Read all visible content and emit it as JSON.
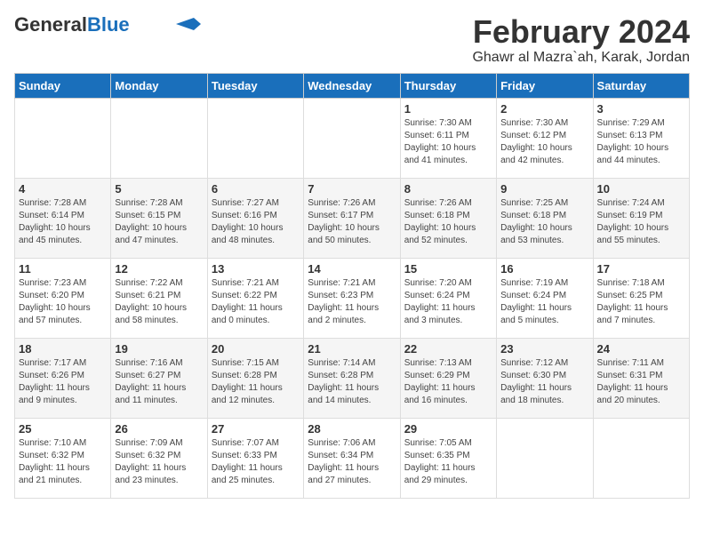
{
  "header": {
    "logo_general": "General",
    "logo_blue": "Blue",
    "title": "February 2024",
    "subtitle": "Ghawr al Mazra`ah, Karak, Jordan"
  },
  "weekdays": [
    "Sunday",
    "Monday",
    "Tuesday",
    "Wednesday",
    "Thursday",
    "Friday",
    "Saturday"
  ],
  "weeks": [
    [
      {
        "day": "",
        "info": ""
      },
      {
        "day": "",
        "info": ""
      },
      {
        "day": "",
        "info": ""
      },
      {
        "day": "",
        "info": ""
      },
      {
        "day": "1",
        "info": "Sunrise: 7:30 AM\nSunset: 6:11 PM\nDaylight: 10 hours\nand 41 minutes."
      },
      {
        "day": "2",
        "info": "Sunrise: 7:30 AM\nSunset: 6:12 PM\nDaylight: 10 hours\nand 42 minutes."
      },
      {
        "day": "3",
        "info": "Sunrise: 7:29 AM\nSunset: 6:13 PM\nDaylight: 10 hours\nand 44 minutes."
      }
    ],
    [
      {
        "day": "4",
        "info": "Sunrise: 7:28 AM\nSunset: 6:14 PM\nDaylight: 10 hours\nand 45 minutes."
      },
      {
        "day": "5",
        "info": "Sunrise: 7:28 AM\nSunset: 6:15 PM\nDaylight: 10 hours\nand 47 minutes."
      },
      {
        "day": "6",
        "info": "Sunrise: 7:27 AM\nSunset: 6:16 PM\nDaylight: 10 hours\nand 48 minutes."
      },
      {
        "day": "7",
        "info": "Sunrise: 7:26 AM\nSunset: 6:17 PM\nDaylight: 10 hours\nand 50 minutes."
      },
      {
        "day": "8",
        "info": "Sunrise: 7:26 AM\nSunset: 6:18 PM\nDaylight: 10 hours\nand 52 minutes."
      },
      {
        "day": "9",
        "info": "Sunrise: 7:25 AM\nSunset: 6:18 PM\nDaylight: 10 hours\nand 53 minutes."
      },
      {
        "day": "10",
        "info": "Sunrise: 7:24 AM\nSunset: 6:19 PM\nDaylight: 10 hours\nand 55 minutes."
      }
    ],
    [
      {
        "day": "11",
        "info": "Sunrise: 7:23 AM\nSunset: 6:20 PM\nDaylight: 10 hours\nand 57 minutes."
      },
      {
        "day": "12",
        "info": "Sunrise: 7:22 AM\nSunset: 6:21 PM\nDaylight: 10 hours\nand 58 minutes."
      },
      {
        "day": "13",
        "info": "Sunrise: 7:21 AM\nSunset: 6:22 PM\nDaylight: 11 hours\nand 0 minutes."
      },
      {
        "day": "14",
        "info": "Sunrise: 7:21 AM\nSunset: 6:23 PM\nDaylight: 11 hours\nand 2 minutes."
      },
      {
        "day": "15",
        "info": "Sunrise: 7:20 AM\nSunset: 6:24 PM\nDaylight: 11 hours\nand 3 minutes."
      },
      {
        "day": "16",
        "info": "Sunrise: 7:19 AM\nSunset: 6:24 PM\nDaylight: 11 hours\nand 5 minutes."
      },
      {
        "day": "17",
        "info": "Sunrise: 7:18 AM\nSunset: 6:25 PM\nDaylight: 11 hours\nand 7 minutes."
      }
    ],
    [
      {
        "day": "18",
        "info": "Sunrise: 7:17 AM\nSunset: 6:26 PM\nDaylight: 11 hours\nand 9 minutes."
      },
      {
        "day": "19",
        "info": "Sunrise: 7:16 AM\nSunset: 6:27 PM\nDaylight: 11 hours\nand 11 minutes."
      },
      {
        "day": "20",
        "info": "Sunrise: 7:15 AM\nSunset: 6:28 PM\nDaylight: 11 hours\nand 12 minutes."
      },
      {
        "day": "21",
        "info": "Sunrise: 7:14 AM\nSunset: 6:28 PM\nDaylight: 11 hours\nand 14 minutes."
      },
      {
        "day": "22",
        "info": "Sunrise: 7:13 AM\nSunset: 6:29 PM\nDaylight: 11 hours\nand 16 minutes."
      },
      {
        "day": "23",
        "info": "Sunrise: 7:12 AM\nSunset: 6:30 PM\nDaylight: 11 hours\nand 18 minutes."
      },
      {
        "day": "24",
        "info": "Sunrise: 7:11 AM\nSunset: 6:31 PM\nDaylight: 11 hours\nand 20 minutes."
      }
    ],
    [
      {
        "day": "25",
        "info": "Sunrise: 7:10 AM\nSunset: 6:32 PM\nDaylight: 11 hours\nand 21 minutes."
      },
      {
        "day": "26",
        "info": "Sunrise: 7:09 AM\nSunset: 6:32 PM\nDaylight: 11 hours\nand 23 minutes."
      },
      {
        "day": "27",
        "info": "Sunrise: 7:07 AM\nSunset: 6:33 PM\nDaylight: 11 hours\nand 25 minutes."
      },
      {
        "day": "28",
        "info": "Sunrise: 7:06 AM\nSunset: 6:34 PM\nDaylight: 11 hours\nand 27 minutes."
      },
      {
        "day": "29",
        "info": "Sunrise: 7:05 AM\nSunset: 6:35 PM\nDaylight: 11 hours\nand 29 minutes."
      },
      {
        "day": "",
        "info": ""
      },
      {
        "day": "",
        "info": ""
      }
    ]
  ]
}
